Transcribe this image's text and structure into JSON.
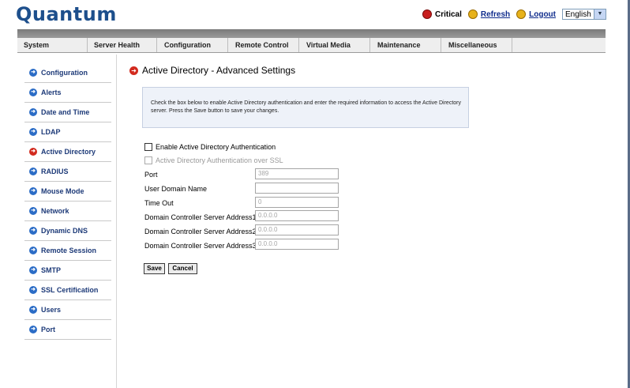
{
  "app": {
    "brand": "Quantum"
  },
  "toolbar": {
    "critical": "Critical",
    "refresh": "Refresh",
    "logout": "Logout",
    "language": "English"
  },
  "nav": {
    "items": [
      "System",
      "Server Health",
      "Configuration",
      "Remote Control",
      "Virtual Media",
      "Maintenance",
      "Miscellaneous"
    ]
  },
  "sidebar": {
    "items": [
      "Configuration",
      "Alerts",
      "Date and Time",
      "LDAP",
      "Active Directory",
      "RADIUS",
      "Mouse Mode",
      "Network",
      "Dynamic DNS",
      "Remote Session",
      "SMTP",
      "SSL Certification",
      "Users",
      "Port"
    ]
  },
  "page": {
    "title": "Active Directory - Advanced Settings",
    "info": "Check the box below to enable Active Directory authentication and enter the required information to access the Active Directory server. Press the Save button to save your changes.",
    "enable_label": "Enable Active Directory Authentication",
    "ssl_label": "Active Directory Authentication over SSL"
  },
  "form": {
    "port_label": "Port",
    "port_value": "389",
    "user_domain_label": "User Domain Name",
    "user_domain_value": "",
    "timeout_label": "Time Out",
    "timeout_value": "0",
    "dc1_label": "Domain Controller Server Address1",
    "dc1_value": "0.0.0.0",
    "dc2_label": "Domain Controller Server Address2",
    "dc2_value": "0.0.0.0",
    "dc3_label": "Domain Controller Server Address3",
    "dc3_value": "0.0.0.0"
  },
  "actions": {
    "save": "Save",
    "cancel": "Cancel"
  },
  "colors": {
    "brand": "#1d4f8c",
    "active_icon": "#d22a1e",
    "sidebar_icon": "#2b6cc6"
  }
}
